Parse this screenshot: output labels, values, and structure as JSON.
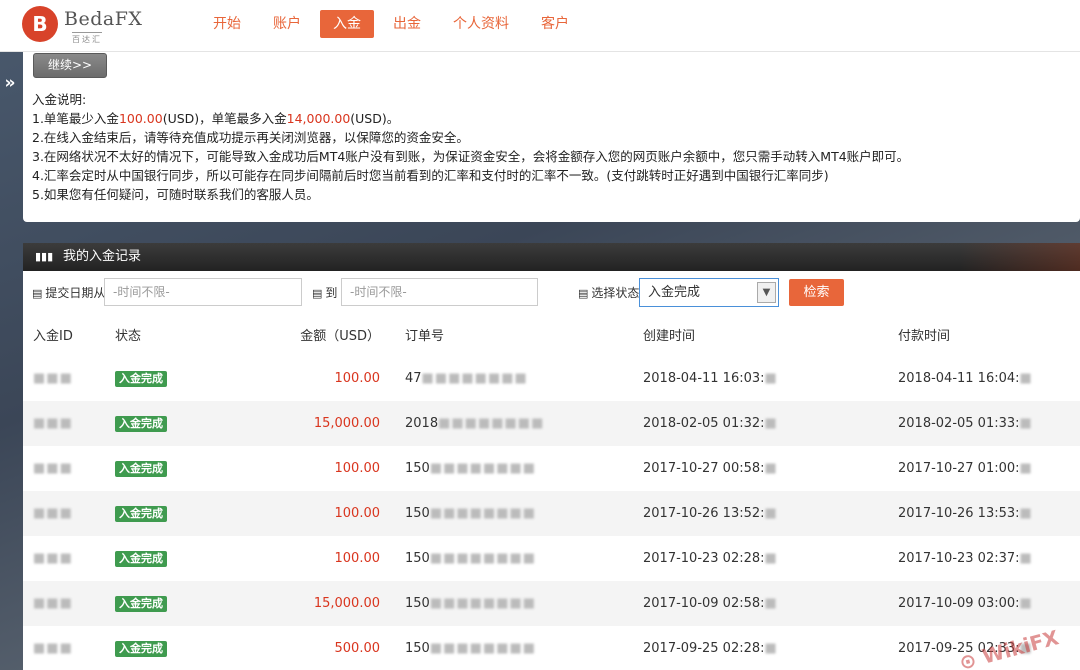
{
  "brand": {
    "name": "BedaFX",
    "sub": "百达汇",
    "mark": "B"
  },
  "nav": [
    "开始",
    "账户",
    "入金",
    "出金",
    "个人资料",
    "客户"
  ],
  "side_toggle": "»",
  "continue_label": "继续>>",
  "info": {
    "title": "入金说明:",
    "line1_a": "1.单笔最少入金",
    "line1_min": "100.00",
    "line1_b": "(USD)，单笔最多入金",
    "line1_max": "14,000.00",
    "line1_c": "(USD)。",
    "line2": "2.在线入金结束后，请等待充值成功提示再关闭浏览器，以保障您的资金安全。",
    "line3": "3.在网络状况不太好的情况下，可能导致入金成功后MT4账户没有到账，为保证资金安全，会将金额存入您的网页账户余额中，您只需手动转入MT4账户即可。",
    "line4": "4.汇率会定时从中国银行同步，所以可能存在同步间隔前后时您当前看到的汇率和支付时的汇率不一致。(支付跳转时正好遇到中国银行汇率同步)",
    "line5": "5.如果您有任何疑问，可随时联系我们的客服人员。"
  },
  "records": {
    "title": "我的入金记录",
    "filter_date_label": "提交日期从",
    "filter_to_label": "到",
    "date_from_placeholder": "-时间不限-",
    "date_to_placeholder": "-时间不限-",
    "status_label": "选择状态",
    "status_value": "入金完成",
    "search_label": "检索",
    "columns": [
      "入金ID",
      "状态",
      "金额（USD）",
      "订单号",
      "创建时间",
      "付款时间"
    ],
    "rows": [
      {
        "status": "入金完成",
        "amount": "100.00",
        "order": "47",
        "created": "2018-04-11 16:03:",
        "paid": "2018-04-11 16:04:"
      },
      {
        "status": "入金完成",
        "amount": "15,000.00",
        "order": "2018",
        "created": "2018-02-05 01:32:",
        "paid": "2018-02-05 01:33:"
      },
      {
        "status": "入金完成",
        "amount": "100.00",
        "order": "150",
        "created": "2017-10-27 00:58:",
        "paid": "2017-10-27 01:00:"
      },
      {
        "status": "入金完成",
        "amount": "100.00",
        "order": "150",
        "created": "2017-10-26 13:52:",
        "paid": "2017-10-26 13:53:"
      },
      {
        "status": "入金完成",
        "amount": "100.00",
        "order": "150",
        "created": "2017-10-23 02:28:",
        "paid": "2017-10-23 02:37:"
      },
      {
        "status": "入金完成",
        "amount": "15,000.00",
        "order": "150",
        "created": "2017-10-09 02:58:",
        "paid": "2017-10-09 03:00:"
      },
      {
        "status": "入金完成",
        "amount": "500.00",
        "order": "150",
        "created": "2017-09-25 02:28:",
        "paid": "2017-09-25 02:33:"
      }
    ]
  },
  "watermark": "WikiFX",
  "colors": {
    "accent": "#e8663a",
    "red": "#d9351e",
    "badge": "#3f9b4f"
  }
}
